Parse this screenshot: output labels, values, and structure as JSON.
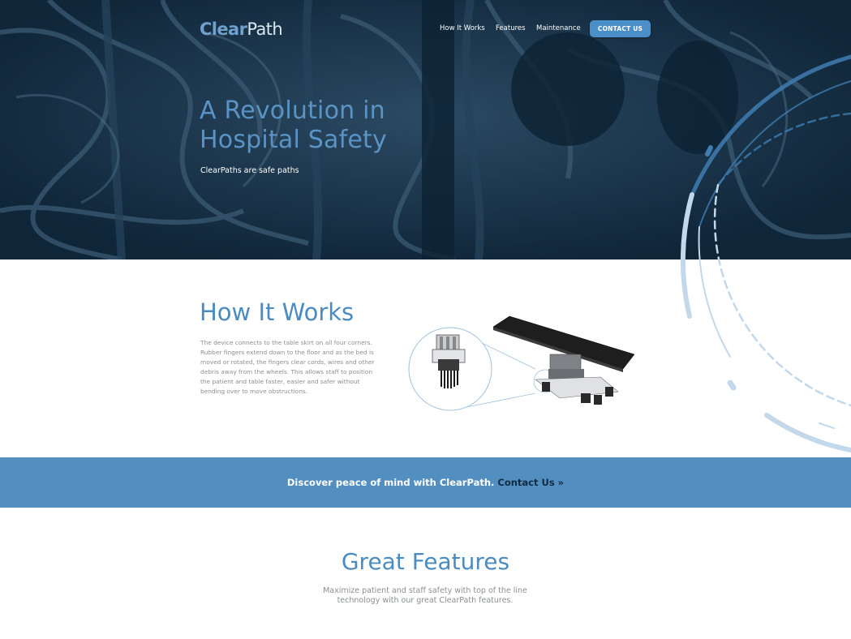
{
  "brand": {
    "name_part1": "Clear",
    "name_part2": "Path"
  },
  "nav": {
    "items": [
      "How It Works",
      "Features",
      "Maintenance"
    ],
    "cta": "CONTACT US"
  },
  "hero": {
    "title_line1": "A Revolution in",
    "title_line2": "Hospital Safety",
    "subtitle": "ClearPaths are safe paths"
  },
  "how": {
    "title": "How It Works",
    "text": "The device connects to the table skirt on all four corners. Rubber fingers extend down to the floor and as the bed is moved or rotated, the fingers clear cords, wires and other debris away from the wheels. This allows staff to position the patient and table faster, easier and safer without bending over to move obstructions."
  },
  "band": {
    "text": "Discover peace of mind with ClearPath.",
    "link": "Contact Us »"
  },
  "features": {
    "title": "Great Features",
    "text": "Maximize patient and staff safety with top of the line technology with our great ClearPath features."
  },
  "colors": {
    "accent": "#538ec0",
    "heading": "#4c8bbf",
    "hero_bg": "#16344b",
    "cta_bg": "#4a8fc8"
  },
  "icons": [
    "clearpath-logo",
    "decorative-arc",
    "device-illustration"
  ]
}
